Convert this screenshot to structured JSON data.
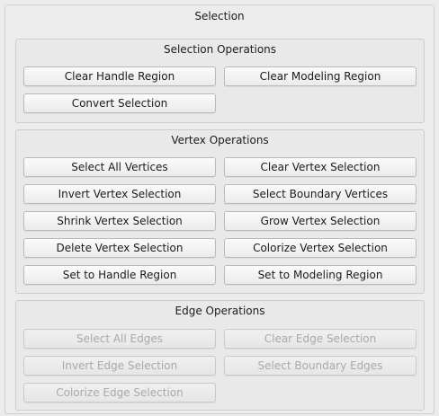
{
  "window": {
    "title": "Selection"
  },
  "groups": [
    {
      "title": "Selection Operations",
      "buttons": [
        {
          "label": "Clear Handle Region",
          "enabled": true
        },
        {
          "label": "Clear Modeling Region",
          "enabled": true
        },
        {
          "label": "Convert Selection",
          "enabled": true
        }
      ]
    },
    {
      "title": "Vertex Operations",
      "buttons": [
        {
          "label": "Select All Vertices",
          "enabled": true
        },
        {
          "label": "Clear Vertex Selection",
          "enabled": true
        },
        {
          "label": "Invert Vertex Selection",
          "enabled": true
        },
        {
          "label": "Select Boundary Vertices",
          "enabled": true
        },
        {
          "label": "Shrink Vertex Selection",
          "enabled": true
        },
        {
          "label": "Grow Vertex Selection",
          "enabled": true
        },
        {
          "label": "Delete Vertex Selection",
          "enabled": true
        },
        {
          "label": "Colorize Vertex Selection",
          "enabled": true
        },
        {
          "label": "Set to Handle Region",
          "enabled": true
        },
        {
          "label": "Set to Modeling Region",
          "enabled": true
        }
      ]
    },
    {
      "title": "Edge Operations",
      "buttons": [
        {
          "label": "Select All Edges",
          "enabled": false
        },
        {
          "label": "Clear Edge Selection",
          "enabled": false
        },
        {
          "label": "Invert Edge Selection",
          "enabled": false
        },
        {
          "label": "Select Boundary Edges",
          "enabled": false
        },
        {
          "label": "Colorize Edge Selection",
          "enabled": false
        }
      ]
    }
  ]
}
